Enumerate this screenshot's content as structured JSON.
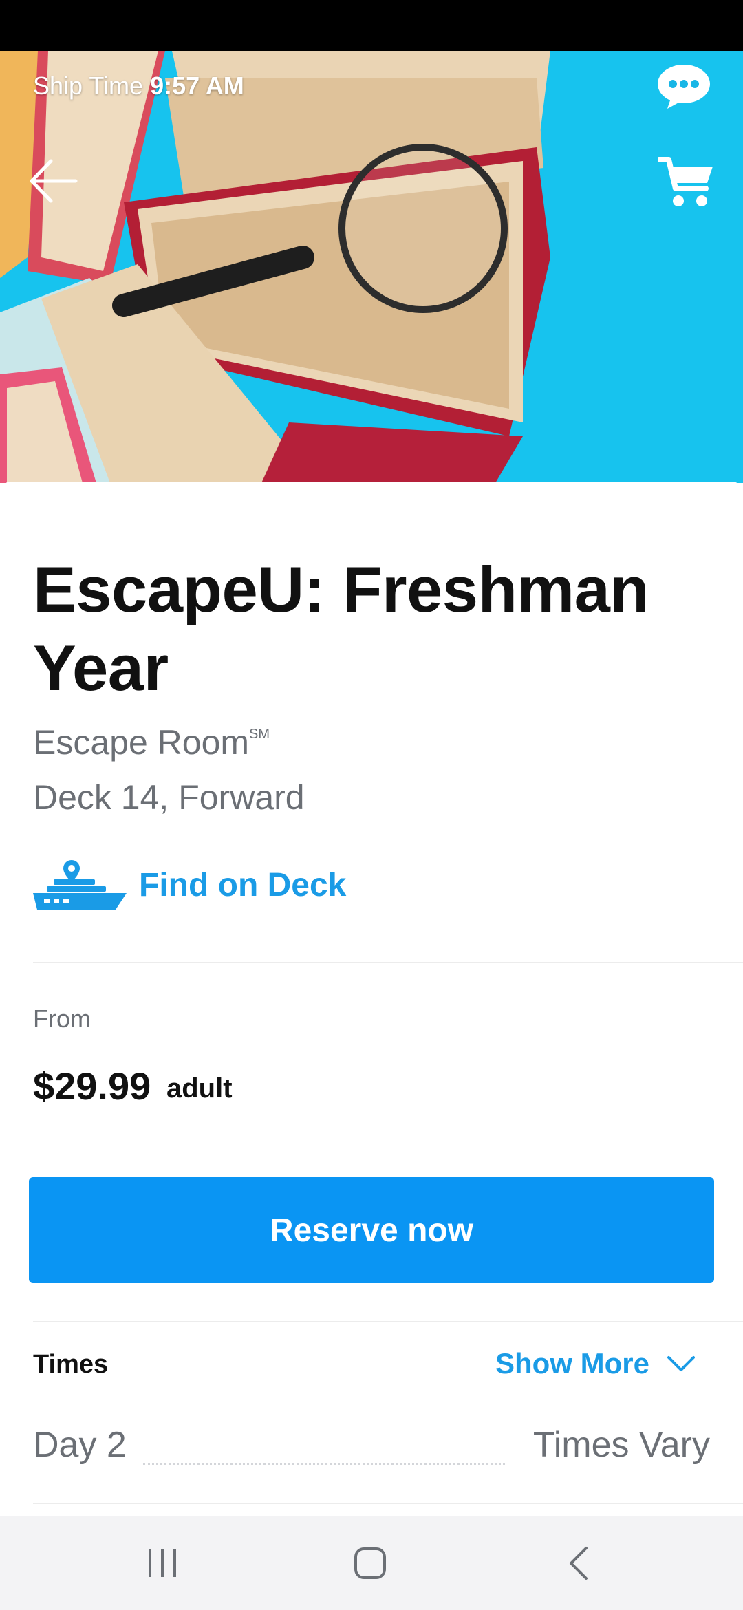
{
  "status_bar": {},
  "header": {
    "ship_time_label": "Ship Time",
    "ship_time_value": "9:57 AM",
    "chat_icon": "chat-bubble-icon",
    "back_icon": "arrow-left-icon",
    "cart_icon": "cart-icon"
  },
  "hero": {
    "description_icon": "books-with-magnifying-glass-image"
  },
  "activity": {
    "title": "EscapeU: Freshman Year",
    "venue_type": "Escape Room",
    "venue_mark": "SM",
    "location": "Deck 14, Forward",
    "find_on_deck_label": "Find on Deck",
    "find_on_deck_icon": "ship-location-icon"
  },
  "pricing": {
    "from_label": "From",
    "price": "$29.99",
    "unit": "adult"
  },
  "reserve": {
    "label": "Reserve now"
  },
  "times": {
    "heading": "Times",
    "show_more_label": "Show More",
    "show_more_icon": "chevron-down-icon",
    "rows": [
      {
        "day": "Day 2",
        "value": "Times Vary"
      }
    ]
  },
  "nav": {
    "recents_icon": "recents-icon",
    "home_icon": "home-icon",
    "back_icon": "back-chevron-icon"
  },
  "colors": {
    "accent": "#1a9be6",
    "button": "#0a95f3",
    "hero_background": "#18c4ee",
    "secondary_text": "#6b6f75"
  }
}
